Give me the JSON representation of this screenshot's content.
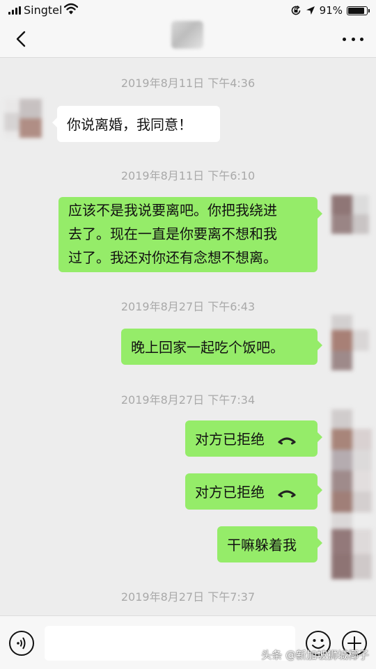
{
  "status_bar": {
    "carrier": "Singtel",
    "battery_text": "91%",
    "battery_level": 0.91,
    "icons": [
      "signal-icon",
      "wifi-icon",
      "screen-lock-icon",
      "location-icon",
      "battery-icon"
    ]
  },
  "nav": {
    "icons": [
      "back-icon",
      "more-icon"
    ]
  },
  "messages": [
    {
      "kind": "timestamp",
      "text": "2019年8月11日 下午4:36"
    },
    {
      "kind": "incoming",
      "text": "你说离婚，我同意！"
    },
    {
      "kind": "timestamp",
      "text": "2019年8月11日 下午6:10"
    },
    {
      "kind": "outgoing",
      "lines": [
        "应该不是我说要离吧。你把我绕进",
        "去了。现在一直是你要离不想和我",
        "过了。我还对你还有念想不想离。"
      ]
    },
    {
      "kind": "timestamp",
      "text": "2019年8月27日 下午6:43"
    },
    {
      "kind": "outgoing",
      "text": "晚上回家一起吃个饭吧。"
    },
    {
      "kind": "timestamp",
      "text": "2019年8月27日 下午7:34"
    },
    {
      "kind": "outgoing-call",
      "text": "对方已拒绝",
      "icon": "declined-call-icon"
    },
    {
      "kind": "outgoing-call",
      "text": "对方已拒绝",
      "icon": "declined-call-icon"
    },
    {
      "kind": "outgoing",
      "text": "干嘛躲着我"
    },
    {
      "kind": "timestamp",
      "text": "2019年8月27日 下午7:37"
    }
  ],
  "input_bar": {
    "value": "",
    "icons": [
      "voice-icon",
      "emoji-icon",
      "add-icon"
    ]
  },
  "watermark": "头条 @新加坡狮城椰子",
  "colors": {
    "background": "#ededed",
    "outgoing_bubble": "#95ec69",
    "incoming_bubble": "#ffffff",
    "timestamp": "#a9a9a9"
  }
}
